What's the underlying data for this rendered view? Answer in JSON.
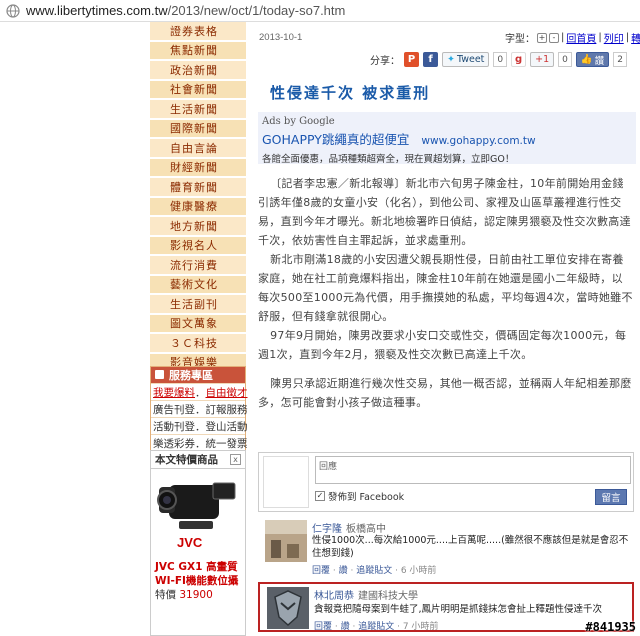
{
  "browser": {
    "url_prefix": "www.libertytimes.com.tw",
    "url_path": "/2013/new/oct/1/today-so7.htm"
  },
  "nav": {
    "items": [
      "證券表格",
      "焦點新聞",
      "政治新聞",
      "社會新聞",
      "生活新聞",
      "國際新聞",
      "自由言論",
      "財經新聞",
      "體育新聞",
      "健康醫療",
      "地方新聞",
      "影視名人",
      "流行消費",
      "藝術文化",
      "生活副刊",
      "圖文萬象",
      "３Ｃ科技",
      "影音娛樂",
      "電影預告"
    ]
  },
  "service": {
    "title": "服務專區",
    "rows": [
      {
        "a": "我要爆料",
        "sep": "．",
        "b": "自由徵才"
      },
      {
        "a": "廣告刊登",
        "sep": "．",
        "b": "訂報服務"
      },
      {
        "a": "活動刊登",
        "sep": "．",
        "b": "登山活動"
      },
      {
        "a": "樂透彩券",
        "sep": "．",
        "b": "統一發票"
      }
    ]
  },
  "product": {
    "header": "本文特價商品",
    "close": "x",
    "brand": "JVC",
    "caption1": "JVC GX1 高畫質",
    "caption2": "WI-FI機能數位攝",
    "price_label": "特價",
    "price": "31900"
  },
  "article": {
    "date": "2013-10-1",
    "fontsize_label": "字型：",
    "fontsize_plus": "+",
    "fontsize_minus": "-",
    "links": [
      "回首頁",
      "列印",
      "轉寄"
    ],
    "share_label": "分享：",
    "tweet_label": "Tweet",
    "tweet_count": "0",
    "gplus_label": "+1",
    "gplus_count": "0",
    "fb_label": "讚",
    "fb_count": "2",
    "title": "性侵達千次 被求重刑",
    "ad_by": "Ads by Google",
    "ad_title": "GOHAPPY跳繩真的超便宜",
    "ad_url": "www.gohappy.com.tw",
    "ad_desc": "各館全面優惠，品項種類超齊全，現在買超划算，立即GO！",
    "p1": "〔記者李忠憲／新北報導〕新北市六旬男子陳金柱，10年前開始用金錢引誘年僅8歲的女童小安（化名），到他公司、家裡及山區草叢裡進行性交易，直到今年才曝光。新北地檢署昨日偵結，認定陳男猥褻及性交次數高達千次，依妨害性自主罪起訴，並求處重刑。",
    "p2": "新北市剛滿18歲的小安因遭父親長期性侵，日前由社工單位安排在寄養家庭，她在社工前竟爆料指出，陳金柱10年前在她還是國小二年級時，以每次500至1000元為代價，用手撫摸她的私處，平均每週4次，當時她雖不舒服，但有錢拿就很開心。",
    "p3": "97年9月開始，陳男改要求小安口交或性交，價碼固定每次1000元，每週1次，直到今年2月，猥褻及性交次數已高達上千次。",
    "p4": "陳男只承認近期進行幾次性交易，其他一概否認，並稱兩人年紀相差那麼多，怎可能會對小孩子做這種事。"
  },
  "comments": {
    "input_placeholder": "回應",
    "post_fb_label": "發佈到 Facebook",
    "post_button": "留言",
    "items": [
      {
        "name": "仁字隆",
        "org": "板橋高中",
        "text": "性侵1000次...每次給1000元....上百萬呢.....(雖然很不應該但是就是會忍不住想到錢)",
        "meta_reply": "回覆",
        "meta_like": "讚",
        "meta_follow": "追蹤貼文",
        "meta_time": "6 小時前"
      },
      {
        "name": "林北周恭",
        "org": "建國科技大學",
        "text": "貪報竟把隨母案到牛蛙了,鳳片明明是抓錢抹怎會扯上釋題性侵達千次",
        "meta_reply": "回覆",
        "meta_like": "讚",
        "meta_follow": "追蹤貼文",
        "meta_time": "7 小時前"
      }
    ]
  },
  "watermark": "#841935"
}
